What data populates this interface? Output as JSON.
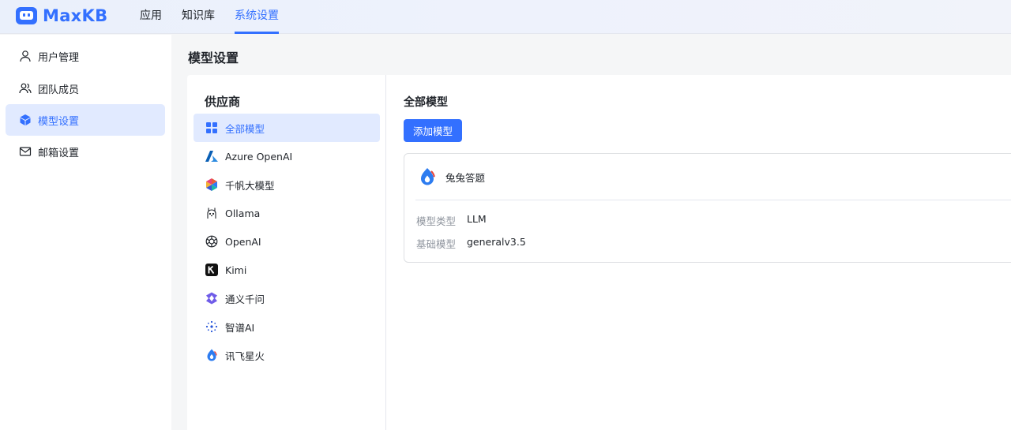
{
  "app": {
    "name": "MaxKB"
  },
  "topnav": [
    {
      "label": "应用",
      "active": false
    },
    {
      "label": "知识库",
      "active": false
    },
    {
      "label": "系统设置",
      "active": true
    }
  ],
  "sidebar": {
    "items": [
      {
        "label": "用户管理",
        "icon": "user-icon",
        "active": false
      },
      {
        "label": "团队成员",
        "icon": "team-icon",
        "active": false
      },
      {
        "label": "模型设置",
        "icon": "cube-icon",
        "active": true
      },
      {
        "label": "邮箱设置",
        "icon": "mail-icon",
        "active": false
      }
    ]
  },
  "main": {
    "title": "模型设置",
    "providers": {
      "title": "供应商",
      "items": [
        {
          "label": "全部模型",
          "icon": "grid-icon",
          "active": true
        },
        {
          "label": "Azure OpenAI",
          "icon": "azure-icon",
          "active": false
        },
        {
          "label": "千帆大模型",
          "icon": "qianfan-icon",
          "active": false
        },
        {
          "label": "Ollama",
          "icon": "ollama-icon",
          "active": false
        },
        {
          "label": "OpenAI",
          "icon": "openai-icon",
          "active": false
        },
        {
          "label": "Kimi",
          "icon": "kimi-icon",
          "active": false
        },
        {
          "label": "通义千问",
          "icon": "tongyi-icon",
          "active": false
        },
        {
          "label": "智谱AI",
          "icon": "zhipu-icon",
          "active": false
        },
        {
          "label": "讯飞星火",
          "icon": "spark-icon",
          "active": false
        }
      ]
    },
    "models": {
      "title": "全部模型",
      "add_label": "添加模型",
      "cards": [
        {
          "name": "兔兔答题",
          "icon": "spark-icon",
          "type_label": "模型类型",
          "type_value": "LLM",
          "base_label": "基础模型",
          "base_value": "generalv3.5"
        }
      ]
    }
  },
  "colors": {
    "accent": "#3370ff",
    "active_bg": "#e1eaff",
    "page_bg": "#f5f6f7"
  }
}
